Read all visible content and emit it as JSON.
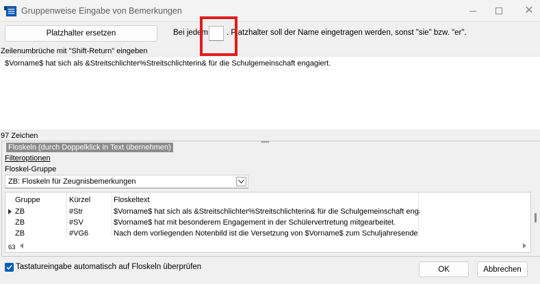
{
  "window": {
    "title": "Gruppenweise Eingabe von Bemerkungen",
    "icon": "app-icon",
    "controls": [
      "minimize-icon",
      "maximize-icon",
      "close-icon"
    ]
  },
  "toolbar": {
    "replace_button_label": "Platzhalter ersetzen",
    "hint_before": "Bei jedem",
    "hint_after": ". Platzhalter soll der Name eingetragen werden, sonst \"sie\" bzw. \"er\".",
    "placeholder_char_value": ""
  },
  "editor": {
    "label": "Zeilenumbrüche mit \"Shift-Return\" eingeben",
    "text": "$Vorname$ hat sich als &Streitschlichter%Streitschlichterin& für die Schulgemeinschaft engagiert.",
    "char_count": "97 Zeichen"
  },
  "floskeln": {
    "group_title": "Floskeln (durch Doppelklick in Text übernehmen)",
    "filter_link": "Filteroptionen",
    "group_select_label": "Floskel-Gruppe",
    "group_select_value": "ZB: Floskeln für Zeugnisbemerkungen",
    "columns": [
      "Gruppe",
      "Kürzel",
      "Floskeltext"
    ],
    "rows": [
      {
        "gruppe": "ZB",
        "kuerzel": "#Str",
        "text": "$Vorname$ hat sich als &Streitschlichter%Streitschlichterin& für die Schulgemeinschaft engag"
      },
      {
        "gruppe": "ZB",
        "kuerzel": "#SV",
        "text": "$Vorname$ hat mit besonderem Engagement in der Schülervertretung mitgearbeitet."
      },
      {
        "gruppe": "ZB",
        "kuerzel": "#VG6",
        "text": "Nach dem vorliegenden Notenbild ist die Versetzung von $Vorname$ zum Schuljahresende ge"
      }
    ],
    "record_count": "63"
  },
  "footer": {
    "auto_check_label": "Tastatureingabe automatisch auf Floskeln überprüfen",
    "auto_check_checked": true,
    "ok_label": "OK",
    "cancel_label": "Abbrechen"
  },
  "colors": {
    "highlight_box": "#e21b1b",
    "checkbox_accent": "#005fb8",
    "legend_bg": "#8c8c8c"
  }
}
